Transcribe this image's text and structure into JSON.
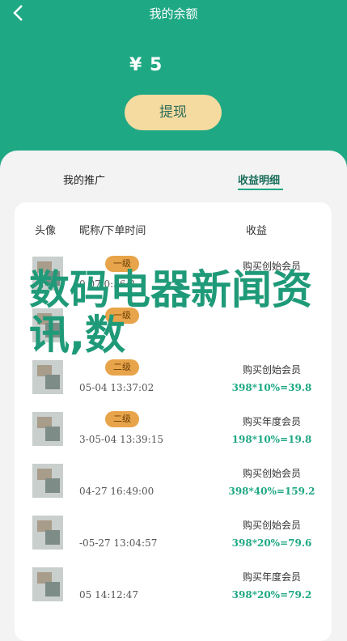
{
  "header": {
    "title": "我的余额",
    "balance": "¥ 5",
    "withdraw_label": "提现"
  },
  "tabs": [
    {
      "label": "我的推广"
    },
    {
      "label": "收益明细"
    }
  ],
  "table": {
    "headers": [
      "头像",
      "昵称/下单时间",
      "收益"
    ],
    "rows": [
      {
        "name": "",
        "level": "一级",
        "time": "0 07 0:36:2",
        "desc": "购买创始会员",
        "calc": ""
      },
      {
        "name": "",
        "level": "一级",
        "time": "",
        "desc": "",
        "calc": ""
      },
      {
        "name": "",
        "level": "二级",
        "time": "05-04 13:37:02",
        "desc": "购买创始会员",
        "calc": "398*10%=39.8"
      },
      {
        "name": "",
        "level": "二级",
        "time": "3-05-04 13:39:15",
        "desc": "购买年度会员",
        "calc": "198*10%=19.8"
      },
      {
        "name": "",
        "level": "",
        "time": "04-27 16:49:00",
        "desc": "购买创始会员",
        "calc": "398*40%=159.2"
      },
      {
        "name": "",
        "level": "",
        "time": "-05-27 13:04:57",
        "desc": "购买创始会员",
        "calc": "398*20%=79.6"
      },
      {
        "name": "",
        "level": "",
        "time": "05 14:12:47",
        "desc": "购买年度会员",
        "calc": "398*20%=79.2"
      }
    ]
  },
  "overlay_text": "数码电器新闻资讯,数"
}
